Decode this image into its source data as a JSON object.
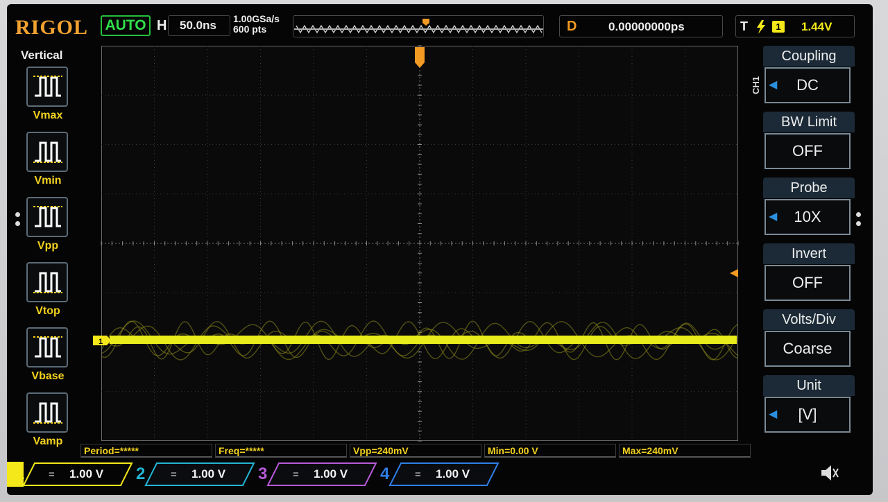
{
  "topbar": {
    "brand": "RIGOL",
    "mode": "AUTO",
    "horizontal_label": "H",
    "timebase": "50.0ns",
    "sample_rate": "1.00GSa/s",
    "points": "600 pts",
    "delay_label": "D",
    "delay_value": "0.00000000ps",
    "trigger_label": "T",
    "trigger_source": "1",
    "trigger_level": "1.44V"
  },
  "vertical_panel": {
    "title": "Vertical",
    "items": [
      {
        "label": "Vmax"
      },
      {
        "label": "Vmin"
      },
      {
        "label": "Vpp"
      },
      {
        "label": "Vtop"
      },
      {
        "label": "Vbase"
      },
      {
        "label": "Vamp"
      }
    ]
  },
  "channel_menu": {
    "channel_tag": "CH1",
    "items": [
      {
        "title": "Coupling",
        "value": "DC",
        "has_arrow": true
      },
      {
        "title": "BW Limit",
        "value": "OFF",
        "has_arrow": false
      },
      {
        "title": "Probe",
        "value": "10X",
        "has_arrow": true
      },
      {
        "title": "Invert",
        "value": "OFF",
        "has_arrow": false
      },
      {
        "title": "Volts/Div",
        "value": "Coarse",
        "has_arrow": false
      },
      {
        "title": "Unit",
        "value": "[V]",
        "has_arrow": true
      }
    ]
  },
  "measurements": [
    "Period=*****",
    "Freq=*****",
    "Vpp=240mV",
    "Min=0.00 V",
    "Max=240mV"
  ],
  "channels": [
    {
      "number": "1",
      "scale": "1.00 V",
      "color": "#f4e81a"
    },
    {
      "number": "2",
      "scale": "1.00 V",
      "color": "#23b5d3"
    },
    {
      "number": "3",
      "scale": "1.00 V",
      "color": "#b65ad8"
    },
    {
      "number": "4",
      "scale": "1.00 V",
      "color": "#2f7fe6"
    }
  ],
  "trace": {
    "channel_marker": "1",
    "color": "#e8ec1c"
  },
  "icons": {
    "trigger_edge": "lightning-icon",
    "speaker": "speaker-icon"
  }
}
